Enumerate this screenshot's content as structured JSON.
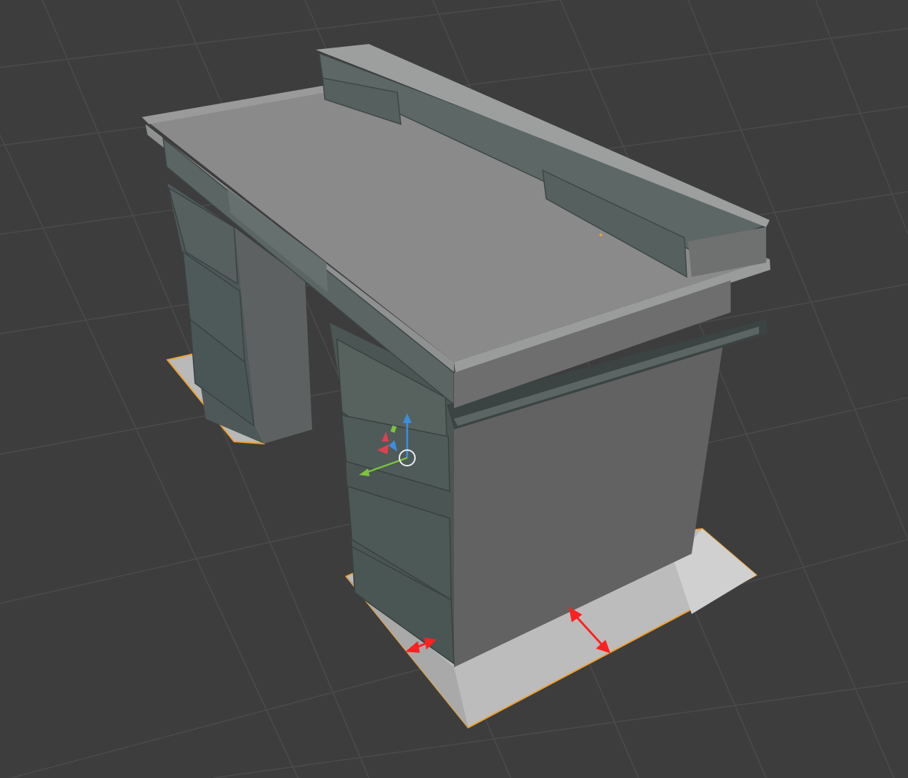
{
  "viewport": {
    "background": "#3d3d3d",
    "grid_color": "#4a4a4a",
    "selection_outline": "#f0a030",
    "gizmo": {
      "x_axis_color": "#e04050",
      "y_axis_color": "#7ac43a",
      "z_axis_color": "#3a8fe0",
      "pivot_color": "#f0f0f0"
    },
    "annotation_arrow_color": "#ff2020"
  },
  "icons": {
    "transform_gizmo": "move-gizmo-icon",
    "pivot": "pivot-circle-icon"
  }
}
